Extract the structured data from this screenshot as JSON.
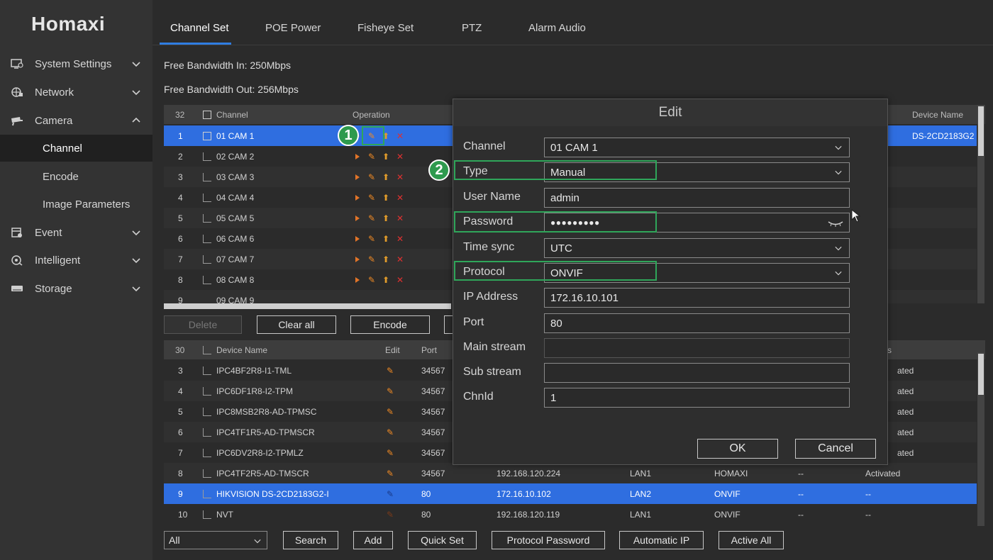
{
  "brand": {
    "logo": "Homaxi"
  },
  "sidebar": {
    "items": [
      {
        "label": "System Settings",
        "icon": "settings-monitor-icon",
        "expanded": false
      },
      {
        "label": "Network",
        "icon": "network-icon",
        "expanded": false
      },
      {
        "label": "Camera",
        "icon": "camera-icon",
        "expanded": true
      },
      {
        "label": "Event",
        "icon": "event-icon",
        "expanded": false
      },
      {
        "label": "Intelligent",
        "icon": "intelligent-icon",
        "expanded": false
      },
      {
        "label": "Storage",
        "icon": "storage-icon",
        "expanded": false
      }
    ],
    "camera_sub": [
      {
        "label": "Channel",
        "active": true
      },
      {
        "label": "Encode",
        "active": false
      },
      {
        "label": "Image Parameters",
        "active": false
      }
    ]
  },
  "tabs": [
    {
      "label": "Channel Set",
      "active": true
    },
    {
      "label": "POE Power",
      "active": false
    },
    {
      "label": "Fisheye Set",
      "active": false
    },
    {
      "label": "PTZ",
      "active": false
    },
    {
      "label": "Alarm Audio",
      "active": false
    }
  ],
  "bandwidth": {
    "in": "Free Bandwidth In: 250Mbps",
    "out": "Free Bandwidth Out: 256Mbps"
  },
  "channel_table": {
    "count": "32",
    "headers": {
      "channel": "Channel",
      "operation": "Operation",
      "device_name": "Device Name"
    },
    "rows": [
      {
        "no": "1",
        "name": "01 CAM 1",
        "device": "DS-2CD2183G2"
      },
      {
        "no": "2",
        "name": "02 CAM 2"
      },
      {
        "no": "3",
        "name": "03 CAM 3"
      },
      {
        "no": "4",
        "name": "04 CAM 4"
      },
      {
        "no": "5",
        "name": "05 CAM 5"
      },
      {
        "no": "6",
        "name": "06 CAM 6"
      },
      {
        "no": "7",
        "name": "07 CAM 7"
      },
      {
        "no": "8",
        "name": "08 CAM 8"
      },
      {
        "no": "9",
        "name": "09 CAM 9"
      }
    ]
  },
  "mid_buttons": {
    "delete": "Delete",
    "clear_all": "Clear all",
    "encode": "Encode"
  },
  "device_table": {
    "count": "30",
    "headers": {
      "device_name": "Device Name",
      "edit": "Edit",
      "port": "Port",
      "status": "s"
    },
    "rows": [
      {
        "no": "3",
        "name": "IPC4BF2R8-I1-TML",
        "port": "34567",
        "ip": "",
        "net": "",
        "proto": "",
        "a": "",
        "status": "ated"
      },
      {
        "no": "4",
        "name": "IPC6DF1R8-I2-TPM",
        "port": "34567",
        "ip": "",
        "net": "",
        "proto": "",
        "a": "",
        "status": "ated"
      },
      {
        "no": "5",
        "name": "IPC8MSB2R8-AD-TPMSC",
        "port": "34567",
        "ip": "",
        "net": "",
        "proto": "",
        "a": "",
        "status": "ated"
      },
      {
        "no": "6",
        "name": "IPC4TF1R5-AD-TPMSCR",
        "port": "34567",
        "ip": "",
        "net": "",
        "proto": "",
        "a": "",
        "status": "ated"
      },
      {
        "no": "7",
        "name": "IPC6DV2R8-I2-TPMLZ",
        "port": "34567",
        "ip": "",
        "net": "",
        "proto": "",
        "a": "",
        "status": "ated"
      },
      {
        "no": "8",
        "name": "IPC4TF2R5-AD-TMSCR",
        "port": "34567",
        "ip": "192.168.120.224",
        "net": "LAN1",
        "proto": "HOMAXI",
        "a": "--",
        "status": "Activated"
      },
      {
        "no": "9",
        "name": "HIKVISION DS-2CD2183G2-I",
        "port": "80",
        "ip": "172.16.10.102",
        "net": "LAN2",
        "proto": "ONVIF",
        "a": "--",
        "status": "--"
      },
      {
        "no": "10",
        "name": "NVT",
        "port": "80",
        "ip": "192.168.120.119",
        "net": "LAN1",
        "proto": "ONVIF",
        "a": "--",
        "status": "--"
      }
    ]
  },
  "bottom_bar": {
    "filter": "All",
    "search": "Search",
    "add": "Add",
    "quick_set": "Quick Set",
    "protocol_password": "Protocol Password",
    "automatic_ip": "Automatic IP",
    "active_all": "Active All"
  },
  "modal": {
    "title": "Edit",
    "fields": {
      "channel": {
        "label": "Channel",
        "value": "01 CAM 1"
      },
      "type": {
        "label": "Type",
        "value": "Manual"
      },
      "username": {
        "label": "User Name",
        "value": "admin"
      },
      "password": {
        "label": "Password",
        "value": "●●●●●●●●●"
      },
      "time_sync": {
        "label": "Time sync",
        "value": "UTC"
      },
      "protocol": {
        "label": "Protocol",
        "value": "ONVIF"
      },
      "ip": {
        "label": "IP Address",
        "value": "172.16.10.101"
      },
      "port": {
        "label": "Port",
        "value": "80"
      },
      "main_stream": {
        "label": "Main stream",
        "value": ""
      },
      "sub_stream": {
        "label": "Sub stream",
        "value": ""
      },
      "chnid": {
        "label": "ChnId",
        "value": "1"
      }
    },
    "ok": "OK",
    "cancel": "Cancel"
  },
  "annotations": {
    "one": "1",
    "two": "2"
  },
  "colors": {
    "accent_blue": "#2f6ee0",
    "highlight_green": "#2fa65a",
    "edit_orange": "#f08a24",
    "delete_red": "#e03030"
  }
}
